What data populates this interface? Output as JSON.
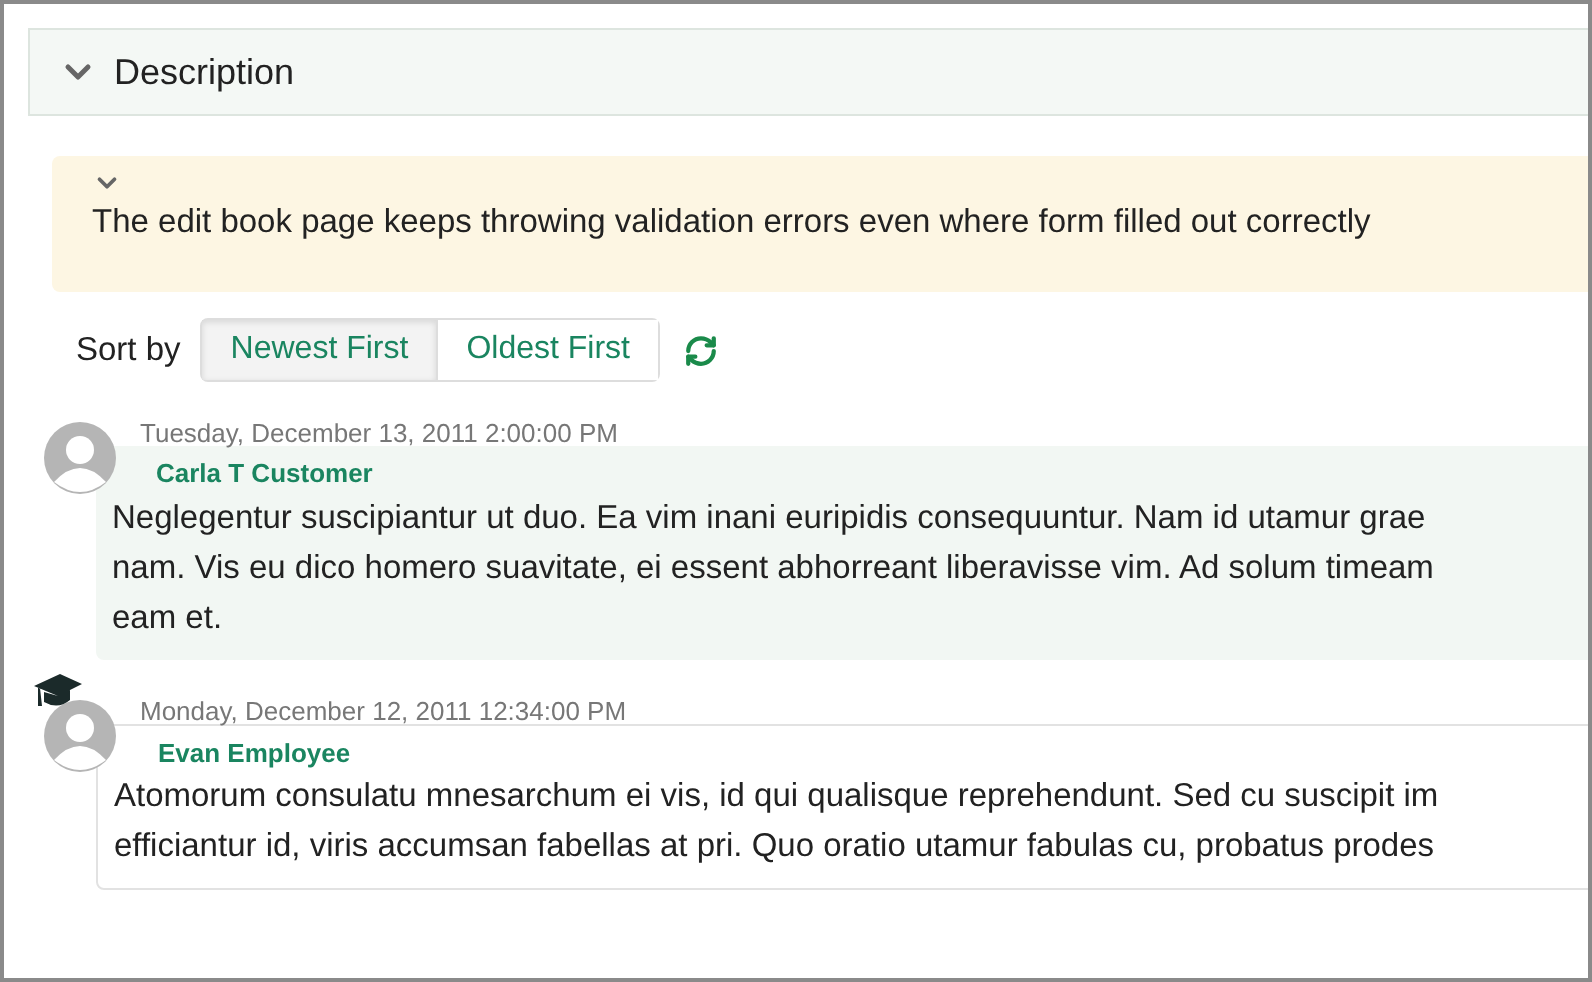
{
  "section": {
    "title": "Description",
    "expanded": true
  },
  "description": {
    "expanded": true,
    "text": "The edit book page keeps throwing validation errors even where form filled out correctly"
  },
  "sort": {
    "label": "Sort by",
    "options": [
      {
        "label": "Newest First",
        "selected": true
      },
      {
        "label": "Oldest First",
        "selected": false
      }
    ]
  },
  "comments": [
    {
      "date": "Tuesday, December 13, 2011 2:00:00 PM",
      "author": "Carla T Customer",
      "kind": "customer",
      "lines": [
        "Neglegentur suscipiantur ut duo. Ea vim inani euripidis consequuntur. Nam id utamur grae",
        "nam. Vis eu dico homero suavitate, ei essent abhorreant liberavisse vim. Ad solum timeam",
        "eam et."
      ]
    },
    {
      "date": "Monday, December 12, 2011 12:34:00 PM",
      "author": "Evan Employee",
      "kind": "employee",
      "lines": [
        "Atomorum consulatu mnesarchum ei vis, id qui qualisque reprehendunt. Sed cu suscipit im",
        "efficiantur id, viris accumsan fabellas at pri. Quo oratio utamur fabulas cu, probatus prodes"
      ]
    }
  ]
}
